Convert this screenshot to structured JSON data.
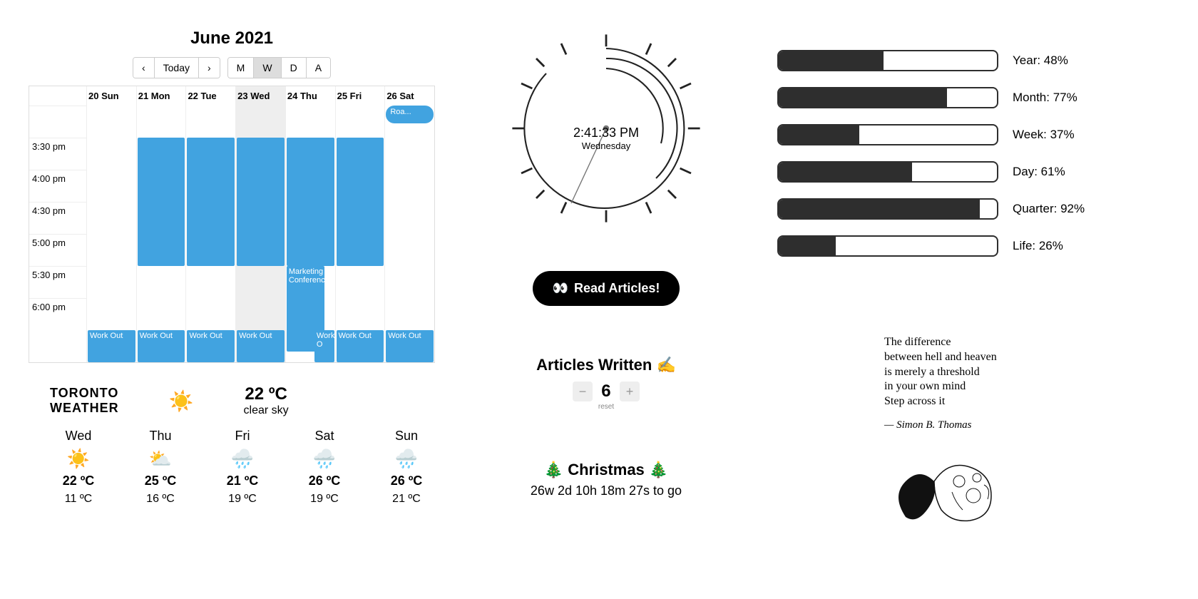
{
  "calendar": {
    "title": "June 2021",
    "nav_today": "Today",
    "views": [
      "M",
      "W",
      "D",
      "A"
    ],
    "active_view": "W",
    "days": [
      "20 Sun",
      "21 Mon",
      "22 Tue",
      "23 Wed",
      "24 Thu",
      "25 Fri",
      "26 Sat"
    ],
    "today_index": 3,
    "hours": [
      "",
      "3:30 pm",
      "4:00 pm",
      "4:30 pm",
      "5:00 pm",
      "5:30 pm",
      "6:00 pm"
    ],
    "event_workout": "Work Out",
    "event_conf": "Marketing Conference",
    "event_roa": "Roa...",
    "event_wk": "Work O"
  },
  "weather": {
    "location_line1": "TORONTO",
    "location_line2": "WEATHER",
    "current_temp": "22 ºC",
    "current_cond": "clear sky",
    "forecast": [
      {
        "day": "Wed",
        "icon": "sun",
        "hi": "22 ºC",
        "lo": "11 ºC"
      },
      {
        "day": "Thu",
        "icon": "partly",
        "hi": "25 ºC",
        "lo": "16 ºC"
      },
      {
        "day": "Fri",
        "icon": "rain",
        "hi": "21 ºC",
        "lo": "19 ºC"
      },
      {
        "day": "Sat",
        "icon": "rain",
        "hi": "26 ºC",
        "lo": "19 ºC"
      },
      {
        "day": "Sun",
        "icon": "rain",
        "hi": "26 ºC",
        "lo": "21 ºC"
      }
    ]
  },
  "clock": {
    "time": "2:41:33 PM",
    "day": "Wednesday"
  },
  "read_button": "Read Articles!",
  "counter": {
    "title": "Articles Written ✍️",
    "value": "6",
    "reset": "reset"
  },
  "countdown": {
    "title": "🎄 Christmas 🎄",
    "remaining": "26w 2d 10h 18m 27s to go"
  },
  "progress": [
    {
      "label": "Year: 48%",
      "pct": 48
    },
    {
      "label": "Month: 77%",
      "pct": 77
    },
    {
      "label": "Week: 37%",
      "pct": 37
    },
    {
      "label": "Day: 61%",
      "pct": 61
    },
    {
      "label": "Quarter: 92%",
      "pct": 92
    },
    {
      "label": "Life: 26%",
      "pct": 26
    }
  ],
  "quote": {
    "text": "The difference\nbetween hell and heaven\nis merely a threshold\nin your own mind\nStep across it",
    "author": "— Simon B. Thomas"
  }
}
